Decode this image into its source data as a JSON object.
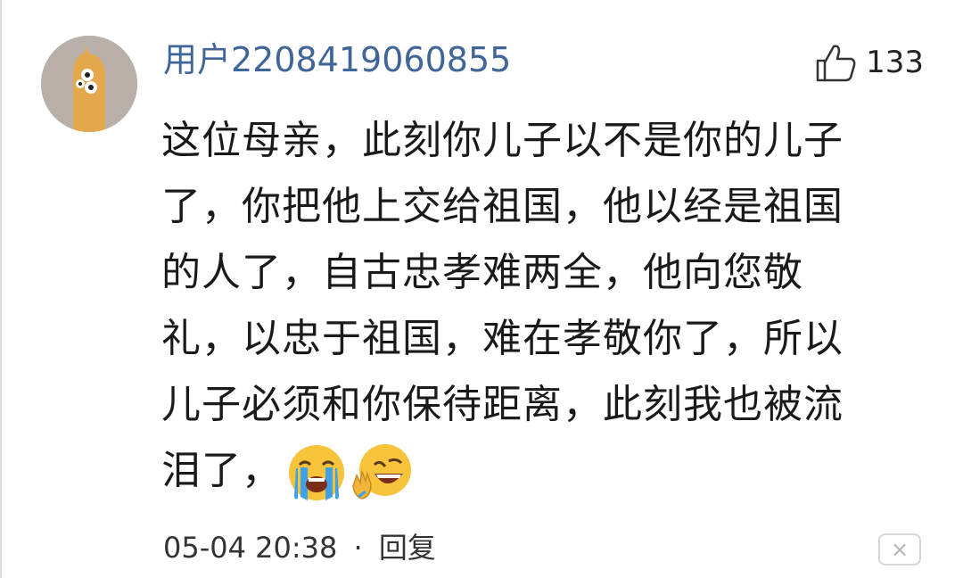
{
  "comment": {
    "username": "用户2208419060855",
    "like_count": "133",
    "content_lines": [
      "这位母亲，此刻你儿子以不是你的儿子",
      "了，你把他上交给祖国，他以经是祖国",
      "的人了，自古忠孝难两全，他向您敬",
      "礼，以忠于祖国，难在孝敬你了，所以",
      "儿子必须和你保待距离，此刻我也被流",
      "泪了，"
    ],
    "emojis": [
      "loudly-crying-emoji",
      "laughing-facepalm-emoji"
    ],
    "timestamp": "05-04 20:38",
    "separator": "·",
    "reply_label": "回复",
    "close_icon": "×"
  },
  "colors": {
    "username": "#406599",
    "text": "#1a1a1a",
    "avatar_bg": "#b8b0a8",
    "emoji_yellow": "#f7c33b",
    "tears": "#3fa2e8"
  }
}
